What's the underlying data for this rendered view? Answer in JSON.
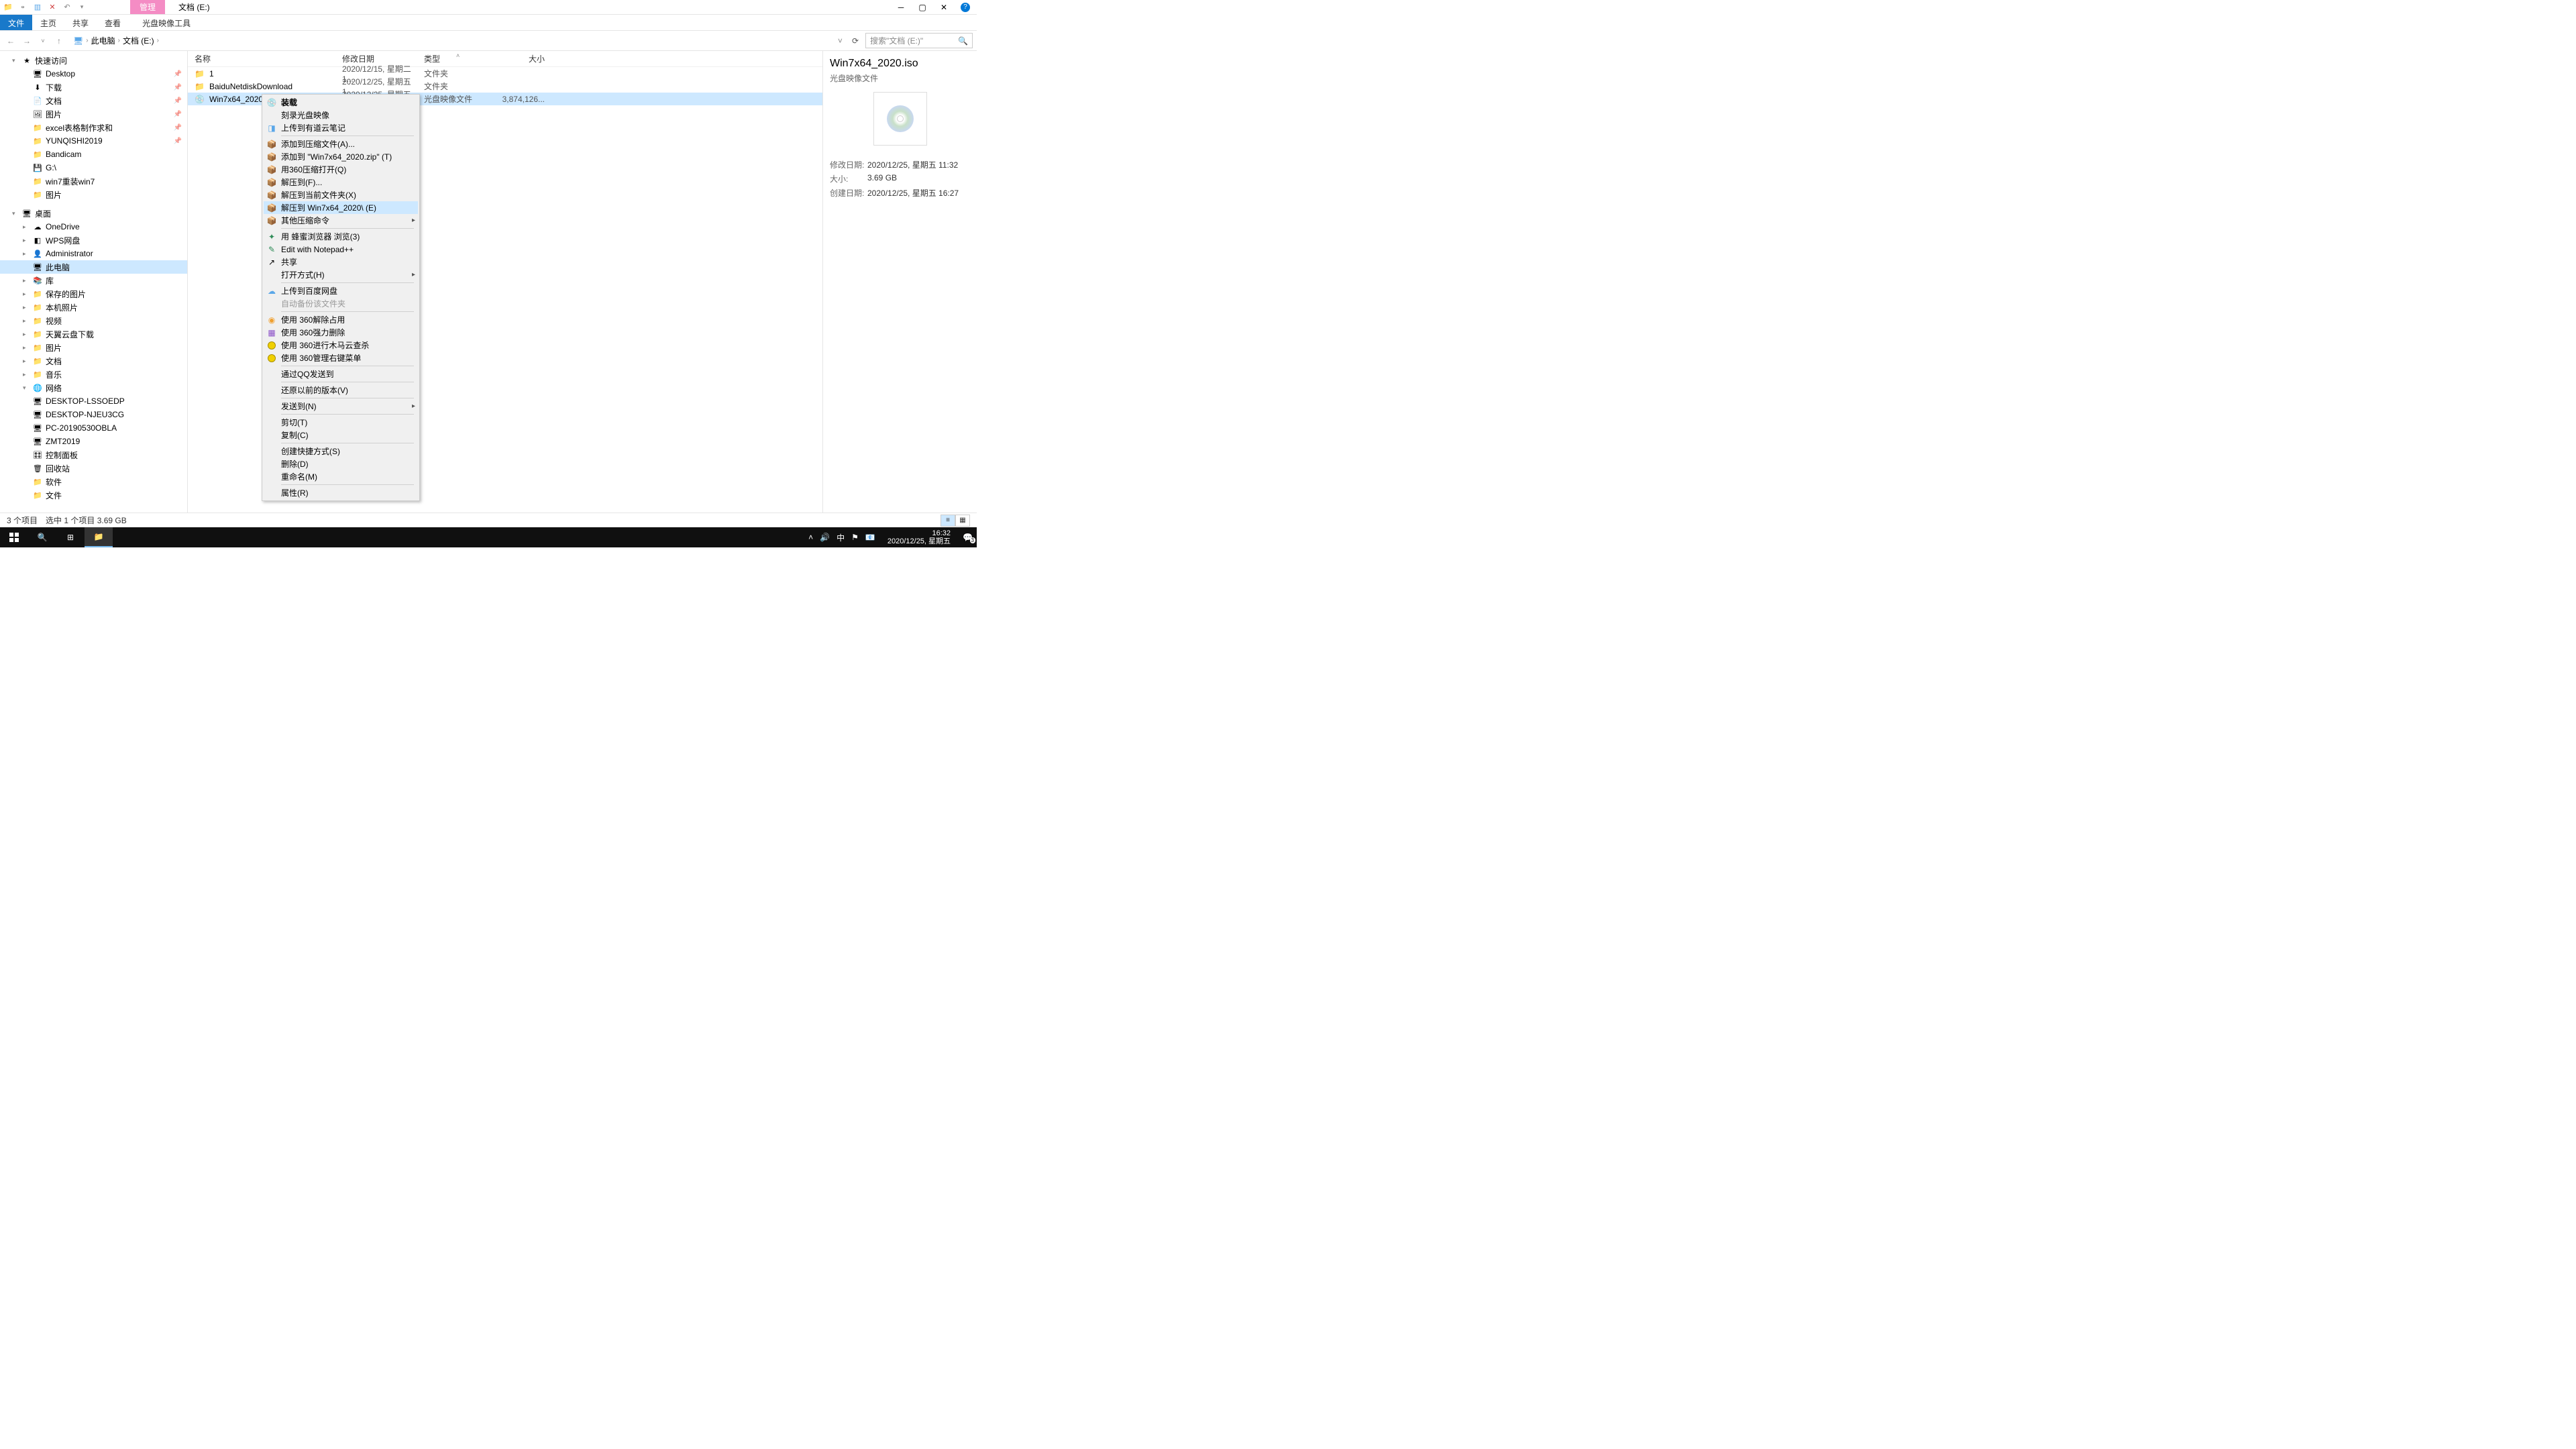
{
  "titlebar": {
    "manage_tab": "管理",
    "title": "文档 (E:)"
  },
  "ribbon": {
    "file": "文件",
    "home": "主页",
    "share": "共享",
    "view": "查看",
    "disc_tools": "光盘映像工具"
  },
  "address": {
    "this_pc": "此电脑",
    "location": "文档 (E:)",
    "search_placeholder": "搜索\"文档 (E:)\""
  },
  "sidebar": {
    "quick_access": "快速访问",
    "items_qa": [
      {
        "label": "Desktop",
        "icon": "🖥",
        "pin": true
      },
      {
        "label": "下载",
        "icon": "⬇",
        "pin": true
      },
      {
        "label": "文档",
        "icon": "📄",
        "pin": true
      },
      {
        "label": "图片",
        "icon": "🖼",
        "pin": true
      },
      {
        "label": "excel表格制作求和",
        "icon": "📁",
        "pin": true
      },
      {
        "label": "YUNQISHI2019",
        "icon": "📁",
        "pin": true
      },
      {
        "label": "Bandicam",
        "icon": "📁"
      },
      {
        "label": "G:\\",
        "icon": "💾"
      },
      {
        "label": "win7重装win7",
        "icon": "📁"
      },
      {
        "label": "图片",
        "icon": "📁"
      }
    ],
    "desktop": "桌面",
    "items_desktop": [
      {
        "label": "OneDrive",
        "icon": "☁"
      },
      {
        "label": "WPS网盘",
        "icon": "◧"
      },
      {
        "label": "Administrator",
        "icon": "👤"
      },
      {
        "label": "此电脑",
        "icon": "🖥",
        "selected": true
      },
      {
        "label": "库",
        "icon": "📚"
      }
    ],
    "items_lib": [
      {
        "label": "保存的图片"
      },
      {
        "label": "本机照片"
      },
      {
        "label": "视频"
      },
      {
        "label": "天翼云盘下载"
      },
      {
        "label": "图片"
      },
      {
        "label": "文档"
      },
      {
        "label": "音乐"
      }
    ],
    "network": "网络",
    "items_net": [
      {
        "label": "DESKTOP-LSSOEDP"
      },
      {
        "label": "DESKTOP-NJEU3CG"
      },
      {
        "label": "PC-20190530OBLA"
      },
      {
        "label": "ZMT2019"
      }
    ],
    "items_bottom": [
      {
        "label": "控制面板",
        "icon": "🎛"
      },
      {
        "label": "回收站",
        "icon": "🗑"
      },
      {
        "label": "软件",
        "icon": "📁"
      },
      {
        "label": "文件",
        "icon": "📁"
      }
    ]
  },
  "columns": {
    "name": "名称",
    "date": "修改日期",
    "type": "类型",
    "size": "大小"
  },
  "files": [
    {
      "name": "1",
      "date": "2020/12/15, 星期二 1...",
      "type": "文件夹",
      "size": "",
      "icon": "folder"
    },
    {
      "name": "BaiduNetdiskDownload",
      "date": "2020/12/25, 星期五 1...",
      "type": "文件夹",
      "size": "",
      "icon": "folder"
    },
    {
      "name": "Win7x64_2020.iso",
      "date": "2020/12/25, 星期五 1...",
      "type": "光盘映像文件",
      "size": "3,874,126...",
      "icon": "disc",
      "selected": true
    }
  ],
  "context_menu": [
    {
      "label": "装载",
      "icon": "💿",
      "bold": true
    },
    {
      "label": "刻录光盘映像"
    },
    {
      "label": "上传到有道云笔记",
      "icon": "◨",
      "iconcolor": "ic-blue"
    },
    {
      "sep": true
    },
    {
      "label": "添加到压缩文件(A)...",
      "icon": "📦",
      "iconcolor": "ic-orange"
    },
    {
      "label": "添加到 \"Win7x64_2020.zip\" (T)",
      "icon": "📦",
      "iconcolor": "ic-orange"
    },
    {
      "label": "用360压缩打开(Q)",
      "icon": "📦",
      "iconcolor": "ic-orange"
    },
    {
      "label": "解压到(F)...",
      "icon": "📦",
      "iconcolor": "ic-orange"
    },
    {
      "label": "解压到当前文件夹(X)",
      "icon": "📦",
      "iconcolor": "ic-orange"
    },
    {
      "label": "解压到 Win7x64_2020\\ (E)",
      "icon": "📦",
      "iconcolor": "ic-orange",
      "highlight": true
    },
    {
      "label": "其他压缩命令",
      "icon": "📦",
      "iconcolor": "ic-orange",
      "arrow": true
    },
    {
      "sep": true
    },
    {
      "label": "用 蜂蜜浏览器 浏览(3)",
      "icon": "✦",
      "iconcolor": "ic-green"
    },
    {
      "label": "Edit with Notepad++",
      "icon": "✎",
      "iconcolor": "ic-green"
    },
    {
      "label": "共享",
      "icon": "↗"
    },
    {
      "label": "打开方式(H)",
      "arrow": true
    },
    {
      "sep": true
    },
    {
      "label": "上传到百度网盘",
      "icon": "☁",
      "iconcolor": "ic-blue"
    },
    {
      "label": "自动备份该文件夹",
      "disabled": true
    },
    {
      "sep": true
    },
    {
      "label": "使用 360解除占用",
      "icon": "◉",
      "iconcolor": "ic-orange"
    },
    {
      "label": "使用 360强力删除",
      "icon": "▦",
      "iconcolor": "ic-purple"
    },
    {
      "label": "使用 360进行木马云查杀",
      "iconraw": "yellow-circle"
    },
    {
      "label": "使用 360管理右键菜单",
      "iconraw": "yellow-circle"
    },
    {
      "sep": true
    },
    {
      "label": "通过QQ发送到"
    },
    {
      "sep": true
    },
    {
      "label": "还原以前的版本(V)"
    },
    {
      "sep": true
    },
    {
      "label": "发送到(N)",
      "arrow": true
    },
    {
      "sep": true
    },
    {
      "label": "剪切(T)"
    },
    {
      "label": "复制(C)"
    },
    {
      "sep": true
    },
    {
      "label": "创建快捷方式(S)"
    },
    {
      "label": "删除(D)"
    },
    {
      "label": "重命名(M)"
    },
    {
      "sep": true
    },
    {
      "label": "属性(R)"
    }
  ],
  "details": {
    "title": "Win7x64_2020.iso",
    "subtype": "光盘映像文件",
    "rows": [
      {
        "k": "修改日期:",
        "v": "2020/12/25, 星期五 11:32"
      },
      {
        "k": "大小:",
        "v": "3.69 GB"
      },
      {
        "k": "创建日期:",
        "v": "2020/12/25, 星期五 16:27"
      }
    ]
  },
  "status": {
    "count": "3 个项目",
    "selection": "选中 1 个项目  3.69 GB"
  },
  "taskbar": {
    "ime": "中",
    "time": "16:32",
    "date": "2020/12/25, 星期五",
    "notif_count": "3"
  }
}
